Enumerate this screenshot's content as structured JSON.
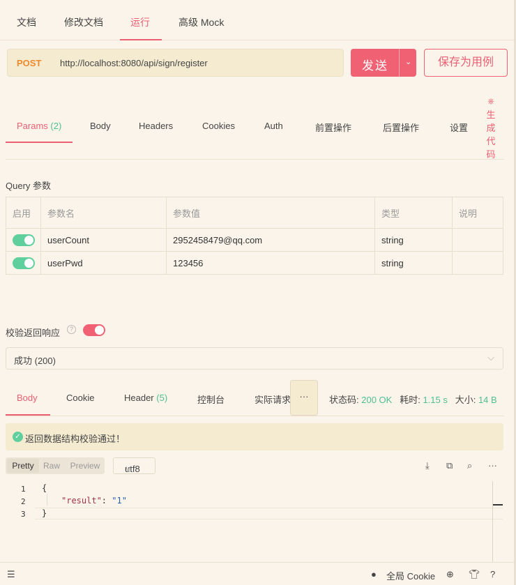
{
  "top_tabs": [
    {
      "label": "文档"
    },
    {
      "label": "修改文档"
    },
    {
      "label": "运行"
    },
    {
      "label": "高级 Mock"
    }
  ],
  "request": {
    "method": "POST",
    "url": "http://localhost:8080/api/sign/register",
    "send_label": "发送",
    "save_label": "保存为用例"
  },
  "request_tabs": [
    {
      "label": "Params",
      "count": "(2)"
    },
    {
      "label": "Body"
    },
    {
      "label": "Headers"
    },
    {
      "label": "Cookies"
    },
    {
      "label": "Auth"
    },
    {
      "label": "前置操作"
    },
    {
      "label": "后置操作"
    },
    {
      "label": "设置"
    }
  ],
  "generate_code": {
    "chars": [
      "生",
      "成",
      "代",
      "码"
    ]
  },
  "query": {
    "section_label": "Query 参数",
    "columns": [
      "启用",
      "参数名",
      "参数值",
      "类型",
      "说明"
    ],
    "rows": [
      {
        "name": "userCount",
        "value": "2952458479@qq.com",
        "type": "string",
        "desc": ""
      },
      {
        "name": "userPwd",
        "value": "123456",
        "type": "string",
        "desc": ""
      }
    ]
  },
  "validate": {
    "label": "校验返回响应",
    "help": "?",
    "selected": "成功 (200)"
  },
  "response_tabs": [
    {
      "label": "Body"
    },
    {
      "label": "Cookie"
    },
    {
      "label": "Header",
      "count": "(5)"
    },
    {
      "label": "控制台"
    },
    {
      "label": "实际请求"
    }
  ],
  "more_label": "···",
  "stats": {
    "status_label": "状态码:",
    "status_value": "200 OK",
    "time_label": "耗时:",
    "time_value": "1.15 s",
    "size_label": "大小:",
    "size_value": "14 B"
  },
  "validation_message": "返回数据结构校验通过！",
  "view_modes": [
    "Pretty",
    "Raw",
    "Preview"
  ],
  "encoding": "utf8",
  "code": {
    "line_numbers": [
      "1",
      "2",
      "3"
    ],
    "open": "{",
    "key": "\"result\"",
    "colon": ": ",
    "value": "\"1\"",
    "close": "}"
  },
  "bottom": {
    "cookie_label": "全局 Cookie"
  },
  "colors": {
    "accent": "#ec5f72",
    "success": "#4fbf91",
    "method": "#ee8a2d",
    "background": "#fbf4ea"
  }
}
